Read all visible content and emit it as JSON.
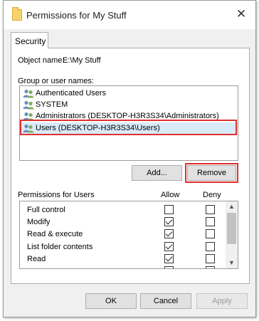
{
  "window": {
    "title": "Permissions for My Stuff",
    "close_icon": "close-icon"
  },
  "tabs": [
    {
      "label": "Security",
      "active": true
    }
  ],
  "object": {
    "label": "Object name:",
    "value": "E:\\My Stuff"
  },
  "groups": {
    "label": "Group or user names:",
    "items": [
      {
        "name": "Authenticated Users",
        "icon": "users-group-icon",
        "selected": false
      },
      {
        "name": "SYSTEM",
        "icon": "users-group-icon",
        "selected": false
      },
      {
        "name": "Administrators (DESKTOP-H3R3S34\\Administrators)",
        "icon": "users-group-icon",
        "selected": false
      },
      {
        "name": "Users (DESKTOP-H3R3S34\\Users)",
        "icon": "users-group-icon",
        "selected": true
      }
    ],
    "add_label": "Add...",
    "remove_label": "Remove"
  },
  "permissions": {
    "label": "Permissions for Users",
    "allow_label": "Allow",
    "deny_label": "Deny",
    "rows": [
      {
        "name": "Full control",
        "allow": false,
        "deny": false
      },
      {
        "name": "Modify",
        "allow": true,
        "deny": false
      },
      {
        "name": "Read & execute",
        "allow": true,
        "deny": false
      },
      {
        "name": "List folder contents",
        "allow": true,
        "deny": false
      },
      {
        "name": "Read",
        "allow": true,
        "deny": false
      }
    ]
  },
  "footer": {
    "ok_label": "OK",
    "cancel_label": "Cancel",
    "apply_label": "Apply"
  },
  "colors": {
    "highlight_border": "#e03030",
    "selected_row": "#d9ebfa"
  }
}
